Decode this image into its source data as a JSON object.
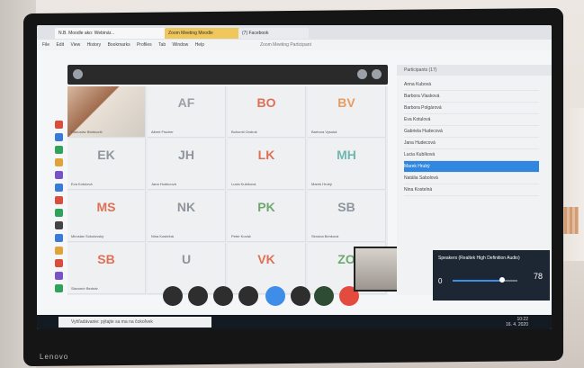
{
  "tabs": [
    {
      "label": "N.B. Moodle ako: Webinár..."
    },
    {
      "label": "Zoom Meeting Moodle"
    },
    {
      "label": "(7) Facebook"
    }
  ],
  "window_title": "Zoom Meeting Participant",
  "menu": [
    "File",
    "Edit",
    "View",
    "History",
    "Bookmarks",
    "Profiles",
    "Tab",
    "Window",
    "Help"
  ],
  "tiles": [
    {
      "initials": "",
      "name": "Radoslav Blaškovič",
      "camera": true
    },
    {
      "initials": "AF",
      "name": "Albert Fischer",
      "color": "#9aa0a6"
    },
    {
      "initials": "BO",
      "name": "Bohumil Ondruš",
      "color": "#e07055"
    },
    {
      "initials": "BV",
      "name": "Barbora Vysoká",
      "color": "#e89c5f"
    },
    {
      "initials": "EK",
      "name": "Eva Kotulová",
      "color": "#8e959c"
    },
    {
      "initials": "JH",
      "name": "Jana Hudecová",
      "color": "#8e959c"
    },
    {
      "initials": "LK",
      "name": "Lucia Kubíková",
      "color": "#e07055"
    },
    {
      "initials": "MH",
      "name": "Marek Hrubý",
      "color": "#6fb8b0"
    },
    {
      "initials": "MS",
      "name": "Miroslav Sokolovský",
      "color": "#e07055"
    },
    {
      "initials": "NK",
      "name": "Nina Kostelná",
      "color": "#8e959c"
    },
    {
      "initials": "PK",
      "name": "Peter Kováč",
      "color": "#6fa86f"
    },
    {
      "initials": "SB",
      "name": "Simona Benková",
      "color": "#8e959c"
    },
    {
      "initials": "SB",
      "name": "Slavomír Bednár",
      "color": "#e07055"
    },
    {
      "initials": "U",
      "name": "",
      "color": "#8e959c"
    },
    {
      "initials": "VK",
      "name": "",
      "color": "#e07055"
    },
    {
      "initials": "ZO",
      "name": "",
      "color": "#6fa86f"
    }
  ],
  "participants_header": "Participants (17)",
  "participants": [
    "Anna Kubová",
    "Barbora Vlasková",
    "Barbora Polgárová",
    "Eva Kotulová",
    "Gabriela Hudecová",
    "Jana Hudecová",
    "Lucia Kubíková",
    "Marek Hrubý",
    "Natália Sabolová",
    "Nina Kostelná"
  ],
  "selected_participant_index": 7,
  "audio": {
    "device": "Speakers (Realtek High Definition Audio)",
    "level": 78,
    "low_label": "0",
    "high_label": "78"
  },
  "taskbar": {
    "search_placeholder": "Vyhľadávanie: pýtajte sa ma na čokoľvek",
    "time": "10:22",
    "date": "16. 4. 2020"
  },
  "laptop_brand": "Lenovo"
}
